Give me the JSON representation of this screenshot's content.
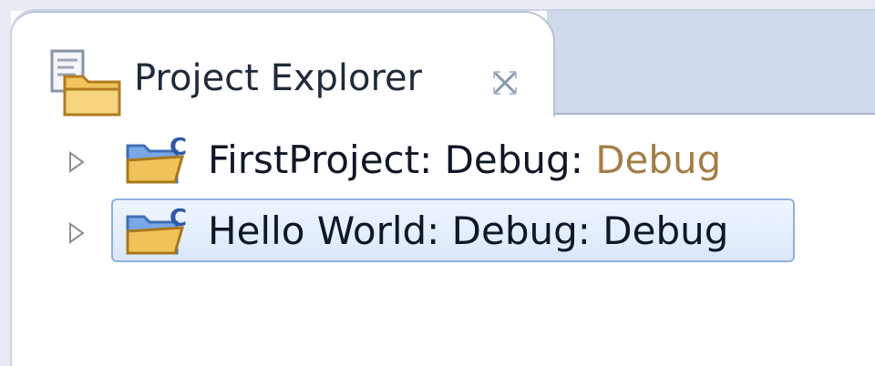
{
  "view": {
    "tab_title": "Project Explorer",
    "close_icon": "close-icon",
    "view_icon": "project-explorer-icon"
  },
  "tree": {
    "items": [
      {
        "name": "FirstProject: Debug:",
        "config": " Debug",
        "selected": false,
        "icon": "c-project-folder-icon",
        "expander": "collapsed-triangle-icon"
      },
      {
        "name": "Hello World: Debug: Debug",
        "config": "",
        "selected": true,
        "icon": "c-project-folder-icon",
        "expander": "collapsed-triangle-icon"
      }
    ]
  },
  "colors": {
    "tabbar": "#cfdaec",
    "selection_border": "#8fb0dc",
    "config_text": "#a37d45"
  }
}
